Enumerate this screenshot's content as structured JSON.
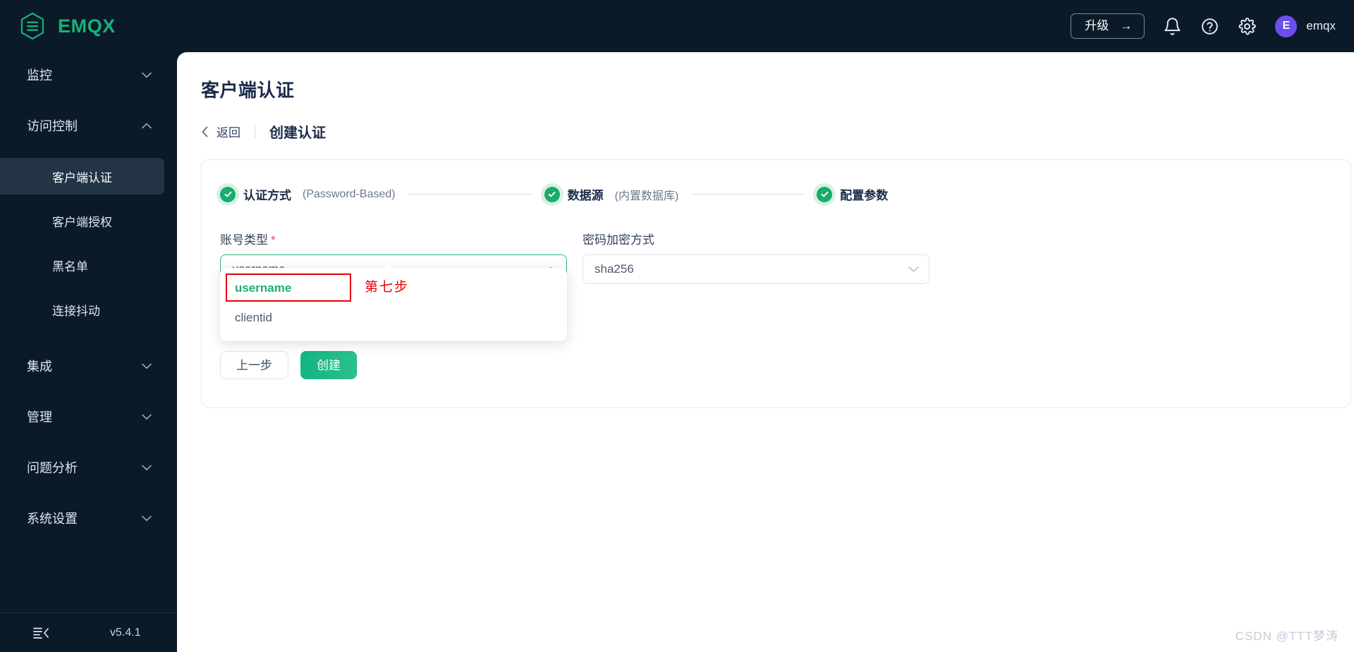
{
  "header": {
    "brand": "EMQX",
    "logo_icon": "emqx-hexagon-logo",
    "upgrade_label": "升级",
    "upgrade_arrow": "→",
    "bell_icon": "bell-icon",
    "help_icon": "question-circle-icon",
    "settings_icon": "gear-icon",
    "avatar_initial": "E",
    "user_name": "emqx"
  },
  "sidebar": {
    "items": [
      {
        "label": "监控",
        "type": "group",
        "expanded": false,
        "chevron": "chevron-down"
      },
      {
        "label": "访问控制",
        "type": "group",
        "expanded": true,
        "chevron": "chevron-up"
      },
      {
        "label": "客户端认证",
        "type": "sub",
        "active": true
      },
      {
        "label": "客户端授权",
        "type": "sub",
        "active": false
      },
      {
        "label": "黑名单",
        "type": "sub",
        "active": false
      },
      {
        "label": "连接抖动",
        "type": "sub",
        "active": false
      },
      {
        "label": "集成",
        "type": "group",
        "expanded": false,
        "chevron": "chevron-down"
      },
      {
        "label": "管理",
        "type": "group",
        "expanded": false,
        "chevron": "chevron-down"
      },
      {
        "label": "问题分析",
        "type": "group",
        "expanded": false,
        "chevron": "chevron-down"
      },
      {
        "label": "系统设置",
        "type": "group",
        "expanded": false,
        "chevron": "chevron-down"
      }
    ],
    "footer": {
      "collapse_icon": "collapse-sidebar-icon",
      "version": "v5.4.1"
    }
  },
  "page": {
    "title": "客户端认证",
    "breadcrumb": {
      "back_icon": "chevron-left-icon",
      "back_label": "返回",
      "current": "创建认证"
    }
  },
  "steps": [
    {
      "label": "认证方式",
      "note": "(Password-Based)",
      "state": "done",
      "icon": "check-icon"
    },
    {
      "label": "数据源",
      "note": "(内置数据库)",
      "state": "done",
      "icon": "check-icon"
    },
    {
      "label": "配置参数",
      "note": "",
      "state": "done",
      "icon": "check-icon"
    }
  ],
  "form": {
    "account_type": {
      "label": "账号类型",
      "required_mark": "*",
      "value": "username",
      "chevron": "chevron-up-icon",
      "open": true,
      "options": [
        "username",
        "clientid"
      ]
    },
    "password_hash": {
      "label": "密码加密方式",
      "value": "sha256",
      "chevron": "chevron-down-icon"
    }
  },
  "annotation": {
    "text": "第七步",
    "color": "#e60000"
  },
  "buttons": {
    "prev_label": "上一步",
    "create_label": "创建"
  },
  "watermark": "CSDN @TTT梦涛",
  "colors": {
    "brand_green": "#16b17a",
    "sidebar_bg": "#0b1a29",
    "sidebar_active_bg": "#223445",
    "primary_green": "#2cb97a",
    "title_navy": "#1b2b4b",
    "avatar_purple": "#6c4ef0",
    "annotation_red": "#e60000"
  }
}
